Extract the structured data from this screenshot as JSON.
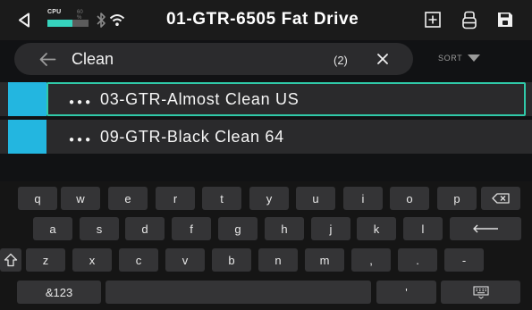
{
  "header": {
    "title": "01-GTR-6505 Fat Drive",
    "cpu_label": "CPU",
    "cpu_percent_text": "60 %",
    "cpu_level": 0.6,
    "icons": [
      "back-triangle-icon",
      "bluetooth-icon",
      "wifi-icon",
      "add-preset-icon",
      "amp-stack-icon",
      "save-icon"
    ]
  },
  "search": {
    "query": "Clean",
    "result_count": "(2)",
    "sort_label": "SORT"
  },
  "results": [
    {
      "name": "03-GTR-Almost Clean US",
      "selected": true
    },
    {
      "name": "09-GTR-Black Clean 64",
      "selected": false
    }
  ],
  "keyboard": {
    "row1": [
      "q",
      "w",
      "e",
      "r",
      "t",
      "y",
      "u",
      "i",
      "o",
      "p"
    ],
    "row2": [
      "a",
      "s",
      "d",
      "f",
      "g",
      "h",
      "j",
      "k",
      "l"
    ],
    "row3": [
      "z",
      "x",
      "c",
      "v",
      "b",
      "n",
      "m",
      ",",
      ".",
      "-"
    ],
    "symbols_label": "&123",
    "apostrophe": "'"
  },
  "colors": {
    "accent_teal": "#30c9a9",
    "swatch_blue": "#23b6e0",
    "cpu_fill": "#36d3bd"
  }
}
